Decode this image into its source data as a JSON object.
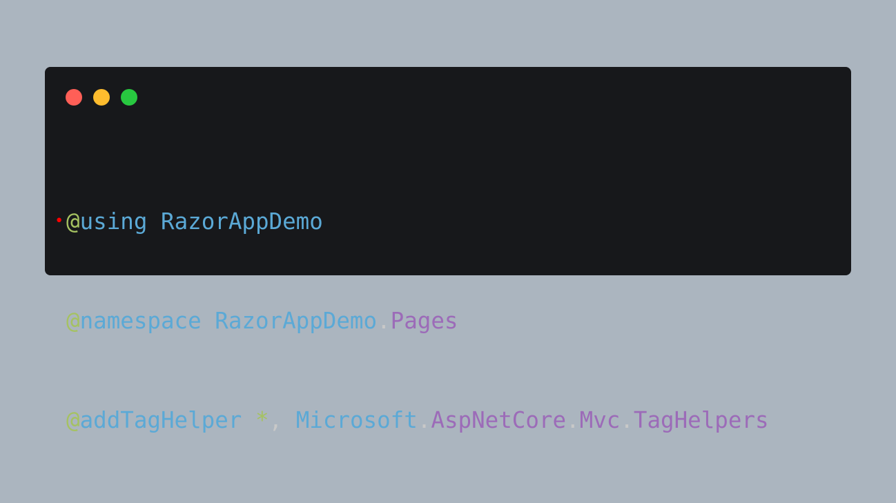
{
  "colors": {
    "background": "#abb5bf",
    "window": "#17181b",
    "dot_red": "#ff5f57",
    "dot_yellow": "#febc2e",
    "dot_green": "#28c840",
    "directive_at": "#a5c261",
    "keyword": "#5ba9d6",
    "type": "#5ba9d6",
    "member": "#9c6bb8",
    "punct": "#c8c8c8",
    "wildcard": "#a5c261",
    "marker": "#ff0000"
  },
  "code": {
    "marker": "•",
    "line1": {
      "at": "@",
      "keyword": "using",
      "space": " ",
      "ns": "RazorAppDemo"
    },
    "line2": {
      "at": "@",
      "keyword": "namespace",
      "space": " ",
      "ns": "RazorAppDemo",
      "dot": ".",
      "member": "Pages"
    },
    "line3": {
      "at": "@",
      "keyword": "addTagHelper",
      "space": " ",
      "wildcard": "*",
      "comma": ", ",
      "ns": "Microsoft",
      "dot1": ".",
      "member1": "AspNetCore",
      "dot2": ".",
      "member2": "Mvc",
      "dot3": ".",
      "member3": "TagHelpers"
    }
  }
}
